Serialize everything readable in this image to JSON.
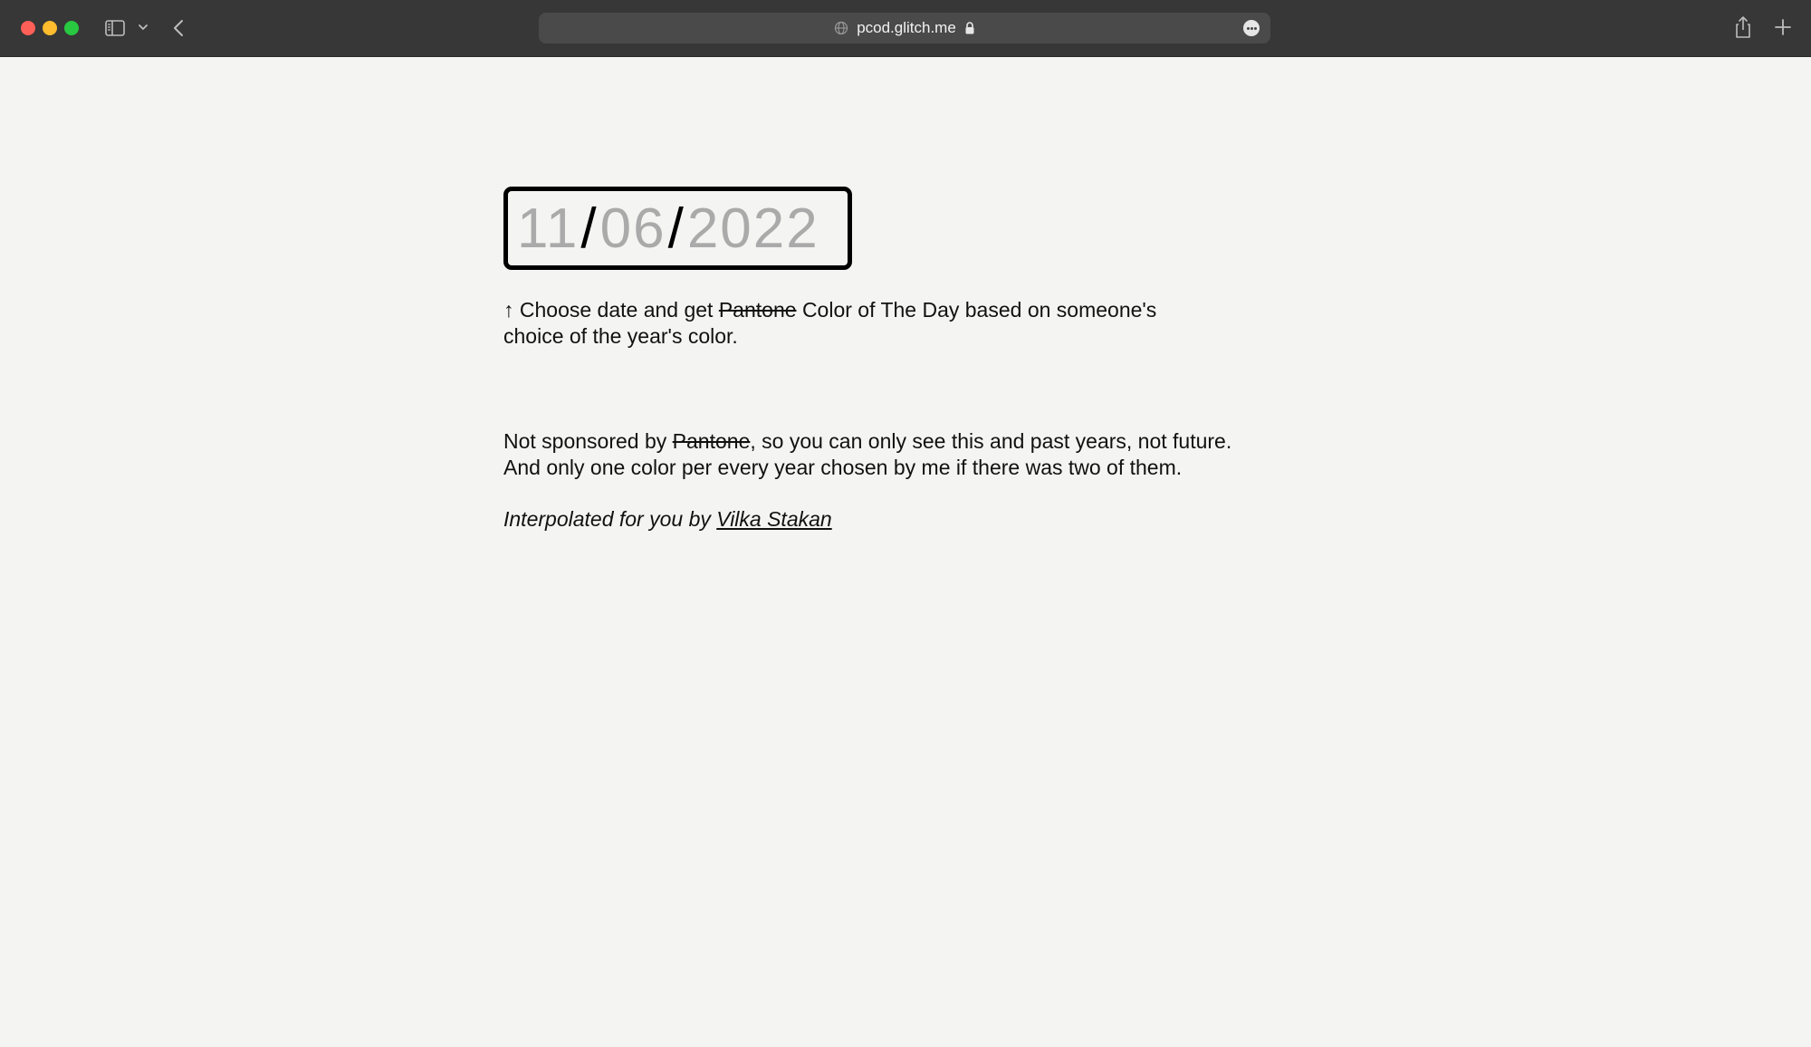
{
  "browser": {
    "url": "pcod.glitch.me",
    "icons": [
      "sidebar-icon",
      "chevron-down-icon",
      "back-icon",
      "globe-icon",
      "lock-icon",
      "more-icon",
      "share-icon",
      "plus-icon"
    ]
  },
  "date_picker": {
    "month": "11",
    "day": "06",
    "year": "2022",
    "separator": "/"
  },
  "intro": {
    "arrow": "↑",
    "part1": "Choose date and get",
    "struck": "Pantone",
    "part2": "Color of The Day based on someone's",
    "line2": "choice of the year's color."
  },
  "note": {
    "part1": "Not sponsored by",
    "struck": "Pantone",
    "part2": ", so you can only see this and past years, not future.",
    "line2": "And only one color per every year chosen by me if there was two of them."
  },
  "credit": {
    "prefix": "Interpolated for you by",
    "author": "Vilka Stakan"
  },
  "colors": {
    "page_background": "#f4f4f3",
    "toolbar": "#373737",
    "placeholder_digits": "#aaaaaa"
  }
}
